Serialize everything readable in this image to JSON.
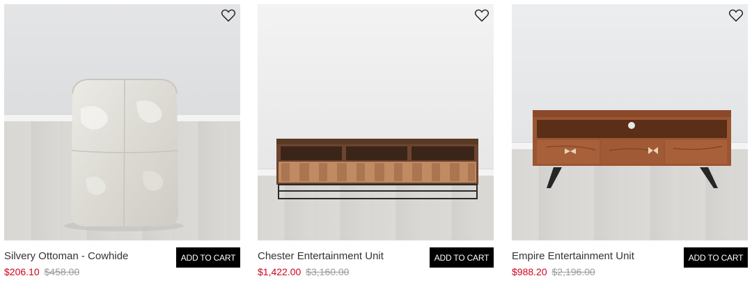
{
  "products": [
    {
      "name": "Silvery Ottoman - Cowhide",
      "sale_price": "$206.10",
      "original_price": "$458.00",
      "cta": "ADD TO CART",
      "wishlist_icon": "heart-outline-icon"
    },
    {
      "name": "Chester Entertainment Unit",
      "sale_price": "$1,422.00",
      "original_price": "$3,160.00",
      "cta": "ADD TO CART",
      "wishlist_icon": "heart-outline-icon"
    },
    {
      "name": "Empire Entertainment Unit",
      "sale_price": "$988.20",
      "original_price": "$2,196.00",
      "cta": "ADD TO CART",
      "wishlist_icon": "heart-outline-icon"
    }
  ],
  "colors": {
    "sale": "#d0021b",
    "original": "#9a9a9a",
    "button_bg": "#000000",
    "button_text": "#ffffff"
  }
}
